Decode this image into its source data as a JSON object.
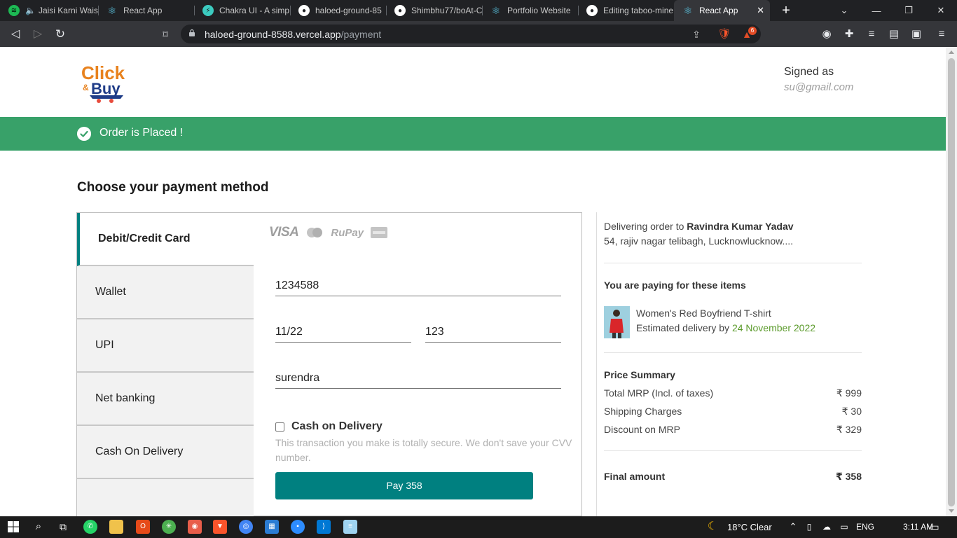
{
  "browser": {
    "tabs": [
      {
        "label": "Jaisi Karni Wais",
        "icon": "spotify-icon",
        "color": "#1db954"
      },
      {
        "label": "React App",
        "icon": "react-icon",
        "color": "#61dafb"
      },
      {
        "label": "Chakra UI - A simp",
        "icon": "chakra-icon",
        "color": "#3ccbc0"
      },
      {
        "label": "haloed-ground-85",
        "icon": "github-icon",
        "color": "#ffffff"
      },
      {
        "label": "Shimbhu77/boAt-C",
        "icon": "github-icon",
        "color": "#ffffff"
      },
      {
        "label": "Portfolio Website",
        "icon": "react-icon",
        "color": "#61dafb"
      },
      {
        "label": "Editing taboo-mine",
        "icon": "github-icon",
        "color": "#ffffff"
      },
      {
        "label": "React App",
        "icon": "react-icon",
        "color": "#61dafb"
      }
    ],
    "url_host": "haloed-ground-8588.vercel.app",
    "url_path": "/payment",
    "brave_badge": "6"
  },
  "header": {
    "signed_label": "Signed as",
    "email": "su@gmail.com"
  },
  "alert": {
    "text": "Order is Placed !",
    "color": "#38a169"
  },
  "payment": {
    "heading": "Choose your payment method",
    "methods": [
      "Debit/Credit Card",
      "Wallet",
      "UPI",
      "Net banking",
      "Cash On Delivery"
    ],
    "card_brands": [
      "VISA",
      "RuPay"
    ],
    "card_number": "1234588",
    "expiry": "11/22",
    "cvv": "123",
    "name": "surendra",
    "cod_label": "Cash on Delivery",
    "secure_note": "This transaction you make is totally secure. We don't save your CVV number.",
    "pay_button": "Pay 358",
    "accent": "#008080"
  },
  "summary": {
    "delivering_prefix": "Delivering order to",
    "customer": "Ravindra Kumar Yadav",
    "address": "54, rajiv nagar telibagh, Lucknowlucknow....",
    "items_heading": "You are paying for these items",
    "item_name": "Women's Red Boyfriend T-shirt",
    "delivery_prefix": "Estimated delivery by",
    "delivery_date": "24 November 2022",
    "price_heading": "Price Summary",
    "rows": [
      {
        "label": "Total MRP (Incl. of taxes)",
        "value": "₹ 999"
      },
      {
        "label": "Shipping Charges",
        "value": "₹ 30"
      },
      {
        "label": "Discount on MRP",
        "value": "₹ 329"
      }
    ],
    "final_label": "Final amount",
    "final_value": "₹ 358"
  },
  "taskbar": {
    "weather": "18°C  Clear",
    "lang": "ENG",
    "time": "3:11 AM"
  }
}
